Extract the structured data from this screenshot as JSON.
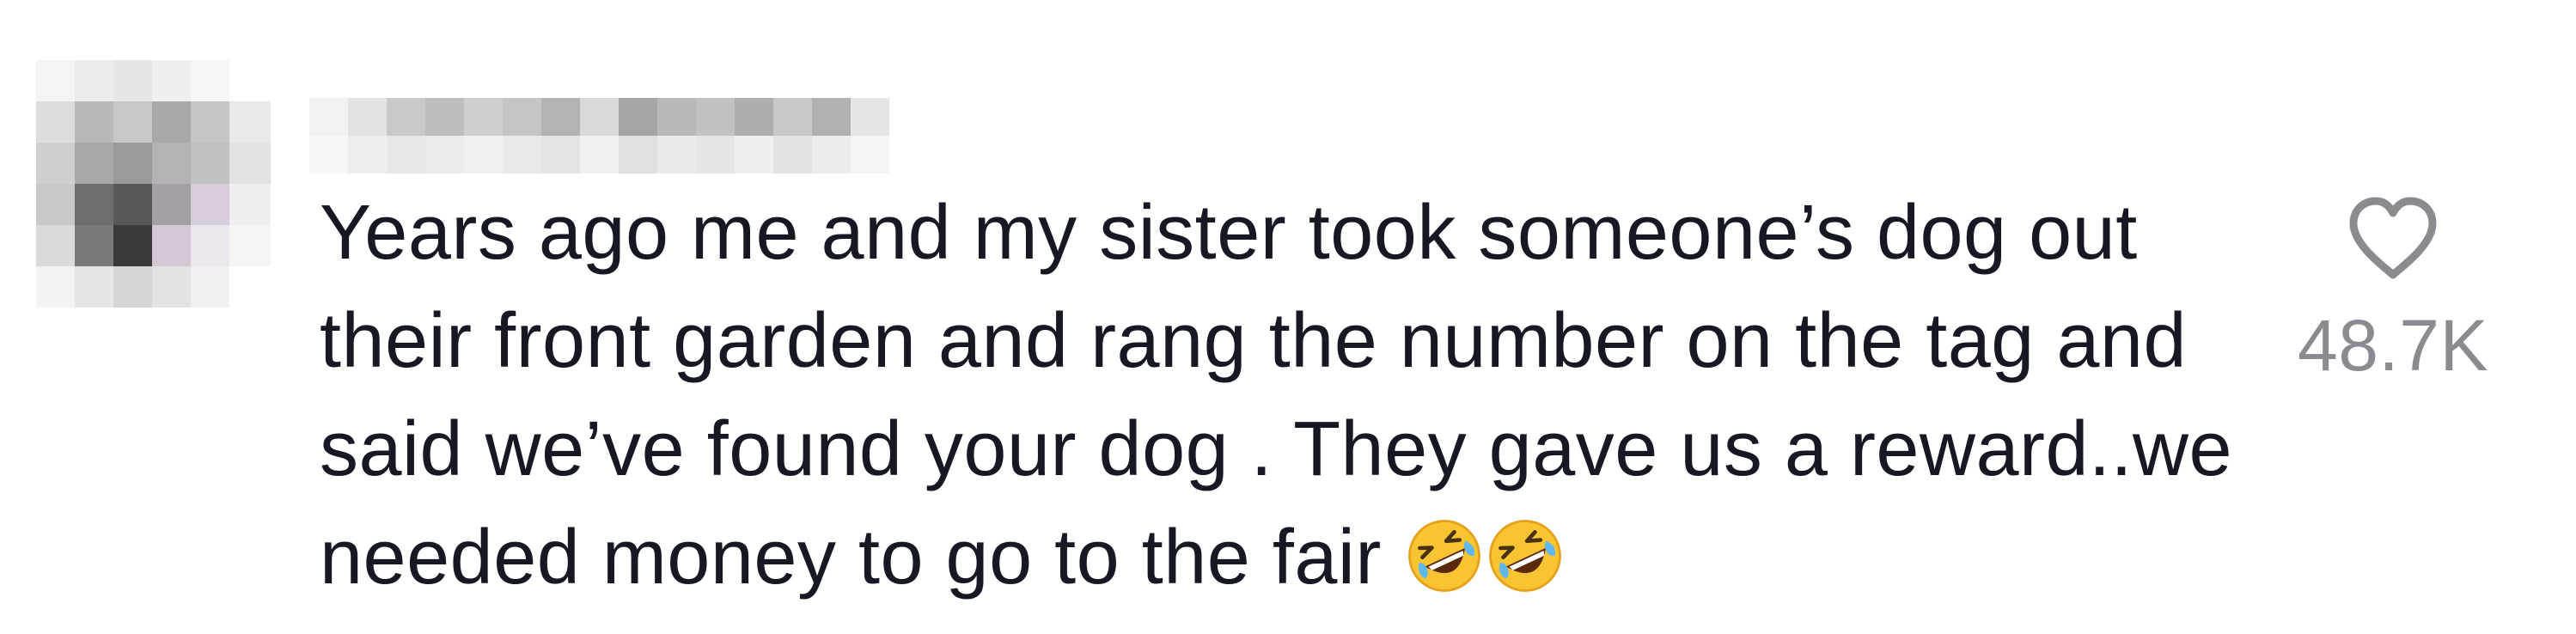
{
  "comment": {
    "text": "Years ago me and my sister took someone’s dog out their front garden and rang the number on the tag and said we’ve found your dog . They gave us a reward..we needed money to go to the fair",
    "emojis": [
      "rolling-on-floor-laughing-icon",
      "rolling-on-floor-laughing-icon"
    ],
    "like_count": "48.7K",
    "like_icon": "heart-outline-icon"
  },
  "colors": {
    "text": "#161823",
    "count": "#8a8b91",
    "background": "#ffffff"
  }
}
